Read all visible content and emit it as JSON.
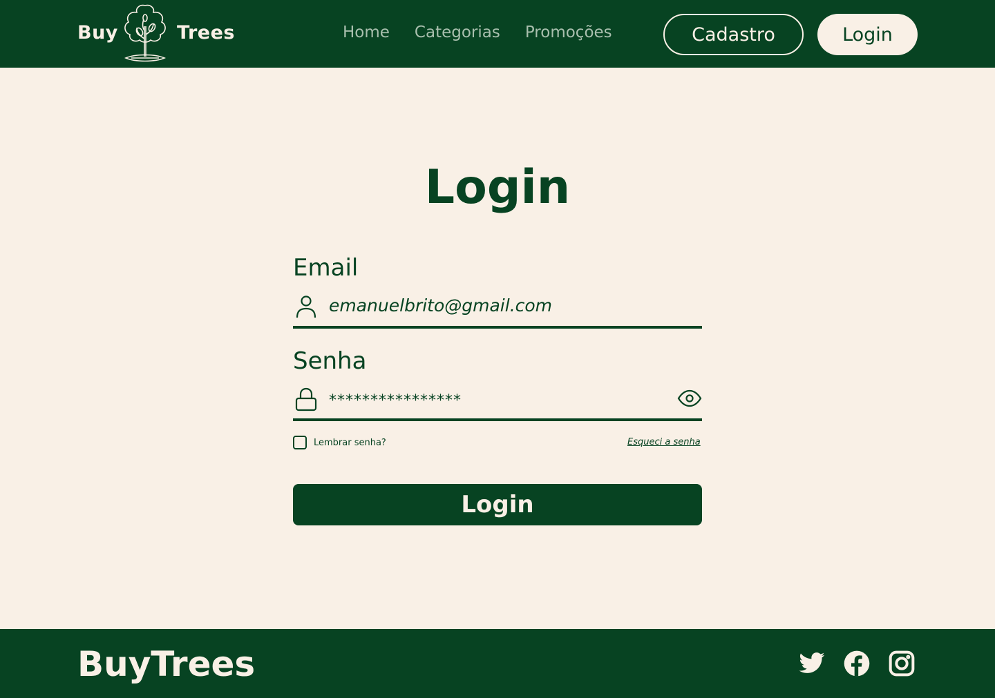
{
  "brand": {
    "word1": "Buy",
    "word2": "Trees",
    "footer_name": "BuyTrees"
  },
  "nav": {
    "items": [
      "Home",
      "Categorias",
      "Promoções"
    ]
  },
  "header": {
    "signup_label": "Cadastro",
    "login_label": "Login"
  },
  "form": {
    "title": "Login",
    "email_label": "Email",
    "email_value": "emanuelbrito@gmail.com",
    "password_label": "Senha",
    "password_value": "****************",
    "remember_label": "Lembrar senha?",
    "forgot_label": "Esqueci a senha",
    "submit_label": "Login"
  },
  "icons": {
    "email_field": "user-icon",
    "password_field": "lock-icon",
    "password_toggle": "eye-icon",
    "social": [
      "twitter-icon",
      "facebook-icon",
      "instagram-icon"
    ]
  },
  "colors": {
    "primary": "#074322",
    "background": "#f9f0e6",
    "nav_text": "#a9bfae"
  }
}
